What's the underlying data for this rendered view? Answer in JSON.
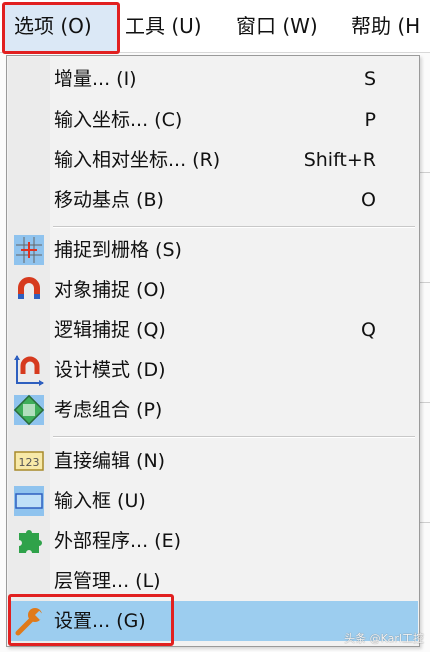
{
  "menubar": {
    "options": "选项 (O)",
    "tools": "工具 (U)",
    "window": "窗口 (W)",
    "help": "帮助 (H"
  },
  "menu": {
    "items": [
      {
        "label": "增量... (I)",
        "shortcut": "S",
        "icon": "none"
      },
      {
        "label": "输入坐标... (C)",
        "shortcut": "P",
        "icon": "none"
      },
      {
        "label": "输入相对坐标... (R)",
        "shortcut": "Shift+R",
        "icon": "none"
      },
      {
        "label": "移动基点 (B)",
        "shortcut": "O",
        "icon": "none"
      },
      {
        "label": "捕捉到栅格 (S)",
        "shortcut": "",
        "icon": "grid-snap-icon"
      },
      {
        "label": "对象捕捉 (O)",
        "shortcut": "",
        "icon": "magnet-icon"
      },
      {
        "label": "逻辑捕捉 (Q)",
        "shortcut": "Q",
        "icon": "none"
      },
      {
        "label": "设计模式 (D)",
        "shortcut": "",
        "icon": "design-mode-icon"
      },
      {
        "label": "考虑组合 (P)",
        "shortcut": "",
        "icon": "group-icon"
      },
      {
        "label": "直接编辑 (N)",
        "shortcut": "",
        "icon": "direct-edit-icon"
      },
      {
        "label": "输入框 (U)",
        "shortcut": "",
        "icon": "input-box-icon"
      },
      {
        "label": "外部程序... (E)",
        "shortcut": "",
        "icon": "puzzle-icon"
      },
      {
        "label": "层管理... (L)",
        "shortcut": "",
        "icon": "none"
      },
      {
        "label": "设置... (G)",
        "shortcut": "",
        "icon": "wrench-icon"
      }
    ]
  },
  "watermark": "头条 @Karl工控",
  "colors": {
    "highlight_border": "#e12020",
    "selected_row": "#9ccdef",
    "menu_bg": "#f2f2f2"
  }
}
